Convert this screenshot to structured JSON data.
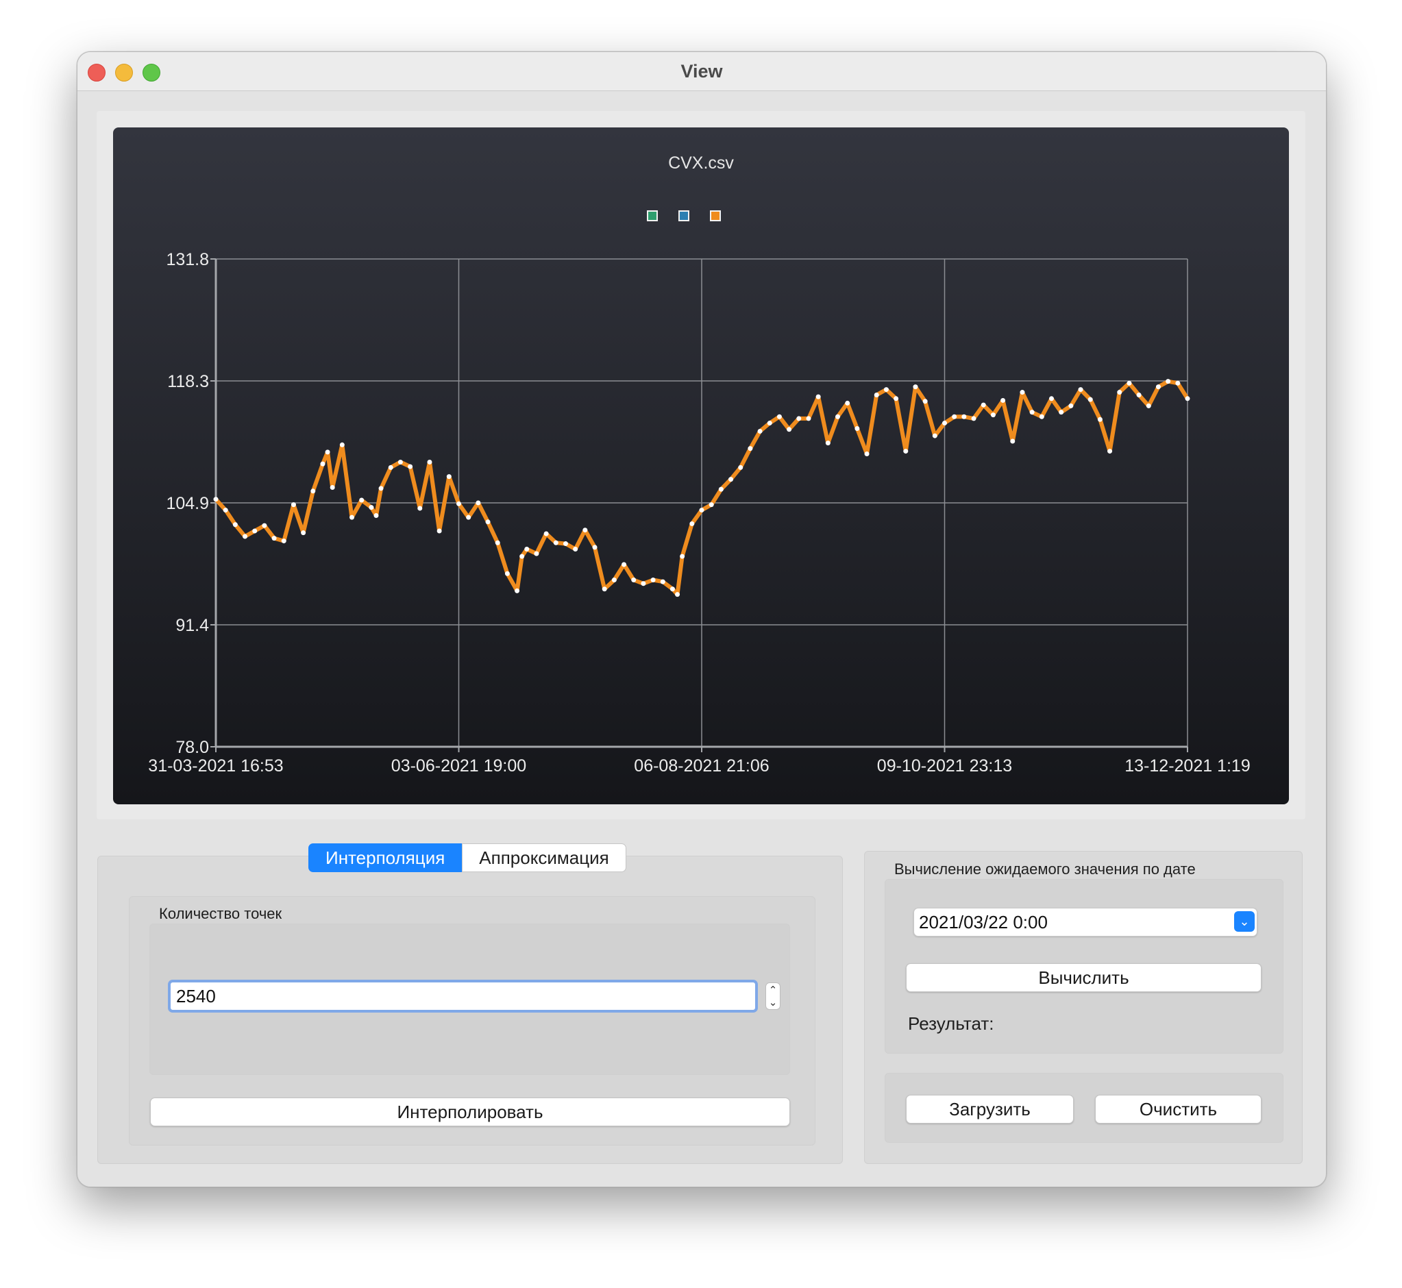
{
  "window": {
    "title": "View"
  },
  "chart_data": {
    "type": "line",
    "title": "CVX.csv",
    "legend": {
      "placement": "top-center",
      "colors": [
        "#2e9e6e",
        "#2c7fb2",
        "#ef8c1e"
      ]
    },
    "series_color": "#ef8c1e",
    "marker_color": "#ffffff",
    "xlabel": "",
    "ylabel": "",
    "ylim": [
      78.0,
      131.8
    ],
    "y_ticks": [
      "131.8",
      "118.3",
      "104.9",
      "91.4",
      "78.0"
    ],
    "x_ticks": [
      "31-03-2021 16:53",
      "03-06-2021 19:00",
      "06-08-2021 21:06",
      "09-10-2021 23:13",
      "13-12-2021 1:19"
    ],
    "grid": true,
    "x_unit": "fraction of x-axis range",
    "series": [
      {
        "x": [
          0,
          0.01,
          0.02,
          0.03,
          0.04,
          0.05,
          0.06,
          0.07,
          0.08,
          0.09,
          0.1,
          0.11,
          0.115,
          0.12,
          0.13,
          0.14,
          0.15,
          0.16,
          0.165,
          0.17,
          0.18,
          0.19,
          0.2,
          0.21,
          0.22,
          0.23,
          0.24,
          0.25,
          0.26,
          0.27,
          0.28,
          0.29,
          0.3,
          0.31,
          0.315,
          0.32,
          0.33,
          0.34,
          0.35,
          0.36,
          0.37,
          0.38,
          0.39,
          0.4,
          0.41,
          0.42,
          0.43,
          0.44,
          0.45,
          0.46,
          0.47,
          0.475,
          0.48,
          0.49,
          0.5,
          0.51,
          0.52,
          0.53,
          0.54,
          0.55,
          0.56,
          0.57,
          0.58,
          0.59,
          0.6,
          0.61,
          0.62,
          0.63,
          0.64,
          0.65,
          0.66,
          0.67,
          0.68,
          0.69,
          0.7,
          0.71,
          0.72,
          0.73,
          0.74,
          0.75,
          0.76,
          0.77,
          0.78,
          0.79,
          0.8,
          0.81,
          0.82,
          0.83,
          0.84,
          0.85,
          0.86,
          0.87,
          0.88,
          0.89,
          0.9,
          0.91,
          0.92,
          0.93,
          0.94,
          0.95,
          0.96,
          0.97,
          0.98,
          0.99,
          1.0
        ],
        "y": [
          105.3,
          104.1,
          102.5,
          101.2,
          101.8,
          102.4,
          101.0,
          100.7,
          104.7,
          101.6,
          106.2,
          109.2,
          110.5,
          106.6,
          111.3,
          103.3,
          105.2,
          104.4,
          103.5,
          106.5,
          108.8,
          109.4,
          108.9,
          104.3,
          109.4,
          101.8,
          107.8,
          104.8,
          103.3,
          104.9,
          102.8,
          100.5,
          97.1,
          95.2,
          99.0,
          99.8,
          99.3,
          101.5,
          100.5,
          100.4,
          99.8,
          101.9,
          100.0,
          95.4,
          96.4,
          98.1,
          96.4,
          96.0,
          96.4,
          96.2,
          95.4,
          94.8,
          99.0,
          102.6,
          104.1,
          104.7,
          106.4,
          107.5,
          108.8,
          110.9,
          112.8,
          113.7,
          114.4,
          113.0,
          114.2,
          114.2,
          116.6,
          111.5,
          114.4,
          115.9,
          113.1,
          110.3,
          116.8,
          117.4,
          116.4,
          110.6,
          117.7,
          116.1,
          112.3,
          113.7,
          114.4,
          114.4,
          114.2,
          115.7,
          114.6,
          116.2,
          111.7,
          117.1,
          114.9,
          114.4,
          116.4,
          114.9,
          115.6,
          117.4,
          116.3,
          114.1,
          110.6,
          117.1,
          118.1,
          116.8,
          115.6,
          117.7,
          118.3,
          118.1,
          116.4
        ]
      }
    ]
  },
  "tabs": [
    {
      "label": "Интерполяция",
      "active": true
    },
    {
      "label": "Аппроксимация",
      "active": false
    }
  ],
  "interpolation": {
    "group_title": "Количество точек",
    "points_value": "2540",
    "button_label": "Интерполировать"
  },
  "calc": {
    "group_title": "Вычисление ожидаемого значения по дате",
    "date_value": "2021/03/22 0:00",
    "button_label": "Вычислить",
    "result_label": "Результат:"
  },
  "actions": {
    "load_label": "Загрузить",
    "clear_label": "Очистить"
  }
}
